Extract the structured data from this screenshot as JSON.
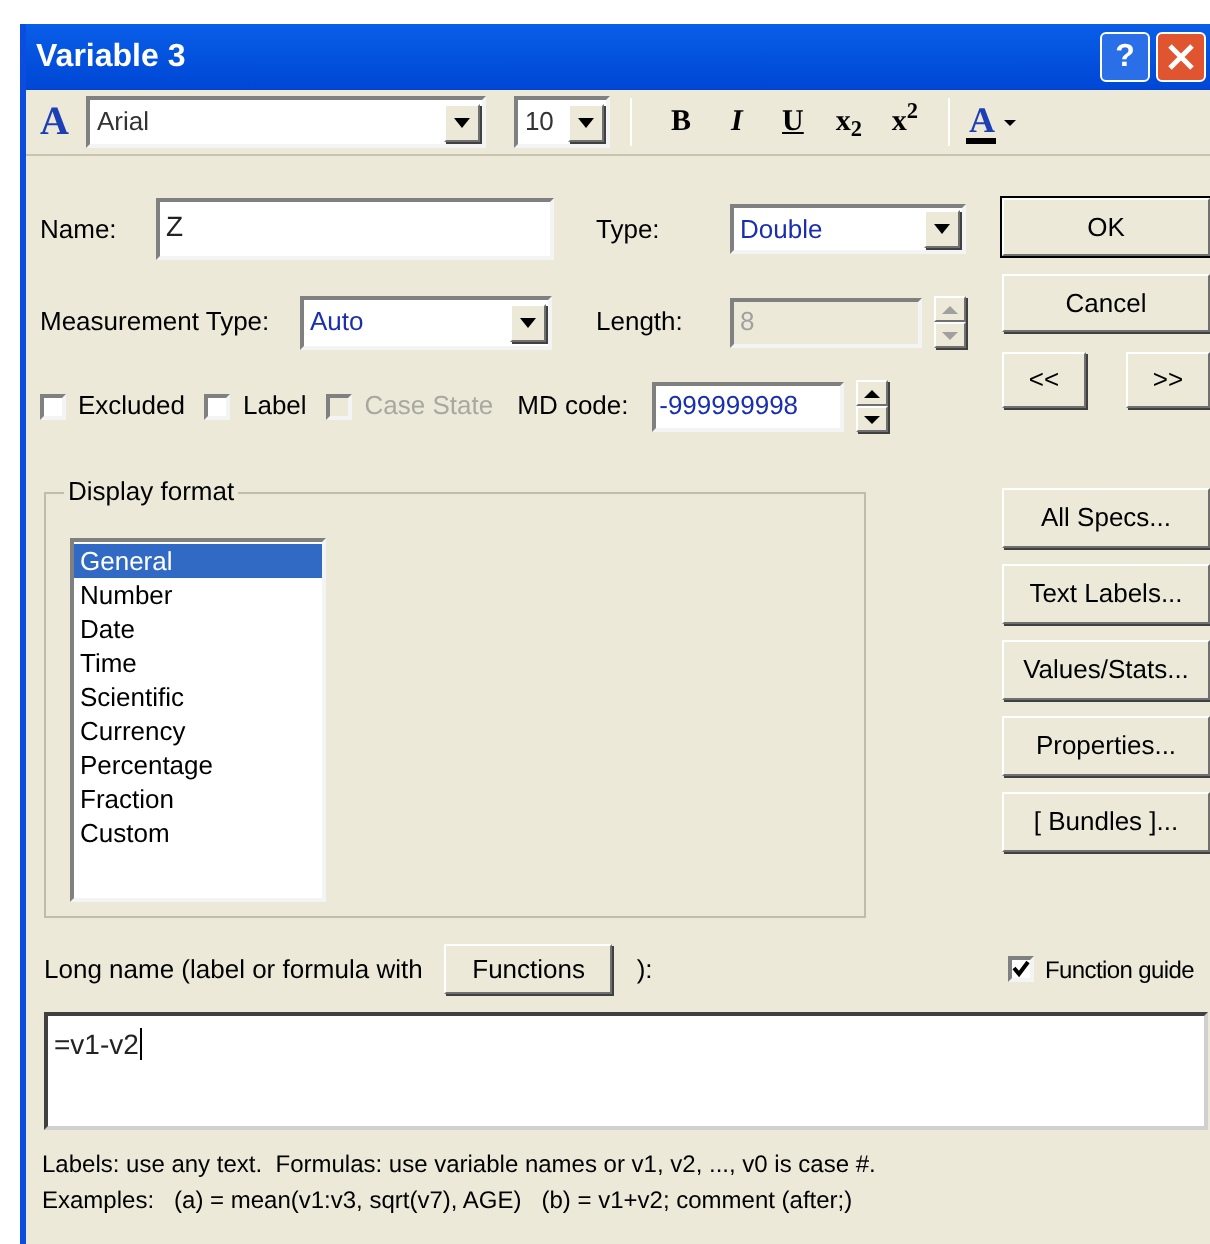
{
  "window": {
    "title": "Variable 3",
    "help_button": "?"
  },
  "toolbar": {
    "style_icon": "A",
    "font": "Arial",
    "size": "10",
    "format_buttons": [
      {
        "label": "B",
        "kind": "bold"
      },
      {
        "label": "I",
        "kind": "italic"
      },
      {
        "label": "U",
        "kind": "underline"
      },
      {
        "label": "x$_{2}$",
        "kind": "script"
      },
      {
        "label": "x$^{2}$",
        "kind": "script"
      }
    ],
    "color_button": "A"
  },
  "name": {
    "label": "Name:",
    "value": "Z"
  },
  "type": {
    "label": "Type:",
    "value": "Double"
  },
  "measurement_type": {
    "label": "Measurement Type:",
    "value": "Auto"
  },
  "length": {
    "label": "Length:",
    "value": "8",
    "disabled": true
  },
  "checkboxes": [
    {
      "label": "Excluded",
      "checked": false,
      "disabled": false
    },
    {
      "label": "Label",
      "checked": false,
      "disabled": false
    },
    {
      "label": "Case State",
      "checked": false,
      "disabled": true
    }
  ],
  "md_code": {
    "label": "MD code:",
    "value": "-999999998"
  },
  "dialog_buttons": [
    "OK",
    "Cancel"
  ],
  "nav_buttons": [
    "<<",
    ">>"
  ],
  "display_format": {
    "legend": "Display format",
    "items": [
      {
        "label": "General",
        "selected": true
      },
      {
        "label": "Number",
        "selected": false
      },
      {
        "label": "Date",
        "selected": false
      },
      {
        "label": "Time",
        "selected": false
      },
      {
        "label": "Scientific",
        "selected": false
      },
      {
        "label": "Currency",
        "selected": false
      },
      {
        "label": "Percentage",
        "selected": false
      },
      {
        "label": "Fraction",
        "selected": false
      },
      {
        "label": "Custom",
        "selected": false
      }
    ]
  },
  "side_buttons": [
    "All Specs...",
    "Text Labels...",
    "Values/Stats...",
    "Properties...",
    "[ Bundles ]..."
  ],
  "long_name": {
    "label": "Long name (label or formula with",
    "button": "Functions",
    "suffix": "):",
    "value": "=v1-v2"
  },
  "function_guide": {
    "label": "Function guide",
    "checked": true
  },
  "help_lines": [
    "Labels: use any text.  Formulas: use variable names or v1, v2, ..., v0 is case #.",
    "Examples:   (a) = mean(v1:v3, sqrt(v7), AGE)   (b) = v1+v2; comment (after;)"
  ]
}
